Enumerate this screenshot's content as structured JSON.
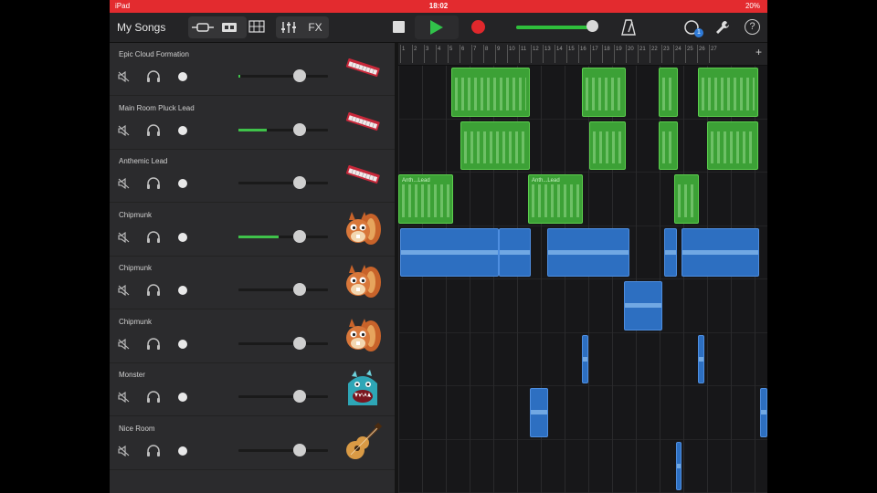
{
  "status_bar": {
    "carrier": "iPad",
    "time": "18:02",
    "battery": "20%"
  },
  "toolbar": {
    "my_songs": "My Songs",
    "fx": "FX"
  },
  "master_volume": 0.92,
  "tracks": [
    {
      "name": "Epic Cloud Formation",
      "instrument": "keyboard-icon",
      "volume": 0.02
    },
    {
      "name": "Main Room Pluck Lead",
      "instrument": "keyboard-icon",
      "volume": 0.32
    },
    {
      "name": "Anthemic Lead",
      "instrument": "keyboard-icon",
      "volume": 0
    },
    {
      "name": "Chipmunk",
      "instrument": "chipmunk-icon",
      "volume": 0.45
    },
    {
      "name": "Chipmunk",
      "instrument": "chipmunk-icon",
      "volume": 0
    },
    {
      "name": "Chipmunk",
      "instrument": "chipmunk-icon",
      "volume": 0
    },
    {
      "name": "Monster",
      "instrument": "monster-icon",
      "volume": 0
    },
    {
      "name": "Nice Room",
      "instrument": "guitar-icon",
      "volume": 0
    }
  ],
  "regions": {
    "anthemic_labels": [
      "Anth...Lead",
      "Anth...Lead"
    ]
  },
  "ruler_marks": [
    "1",
    "2",
    "3",
    "4",
    "5",
    "6",
    "7",
    "8",
    "9",
    "10",
    "11",
    "12",
    "13",
    "14",
    "15",
    "16",
    "17",
    "18",
    "19",
    "20",
    "21",
    "22",
    "23",
    "24",
    "25",
    "26",
    "27"
  ],
  "colors": {
    "accent": "#e32b2f",
    "midi": "#3ca136",
    "audio": "#2d6fc1",
    "level": "#3fc24a"
  }
}
